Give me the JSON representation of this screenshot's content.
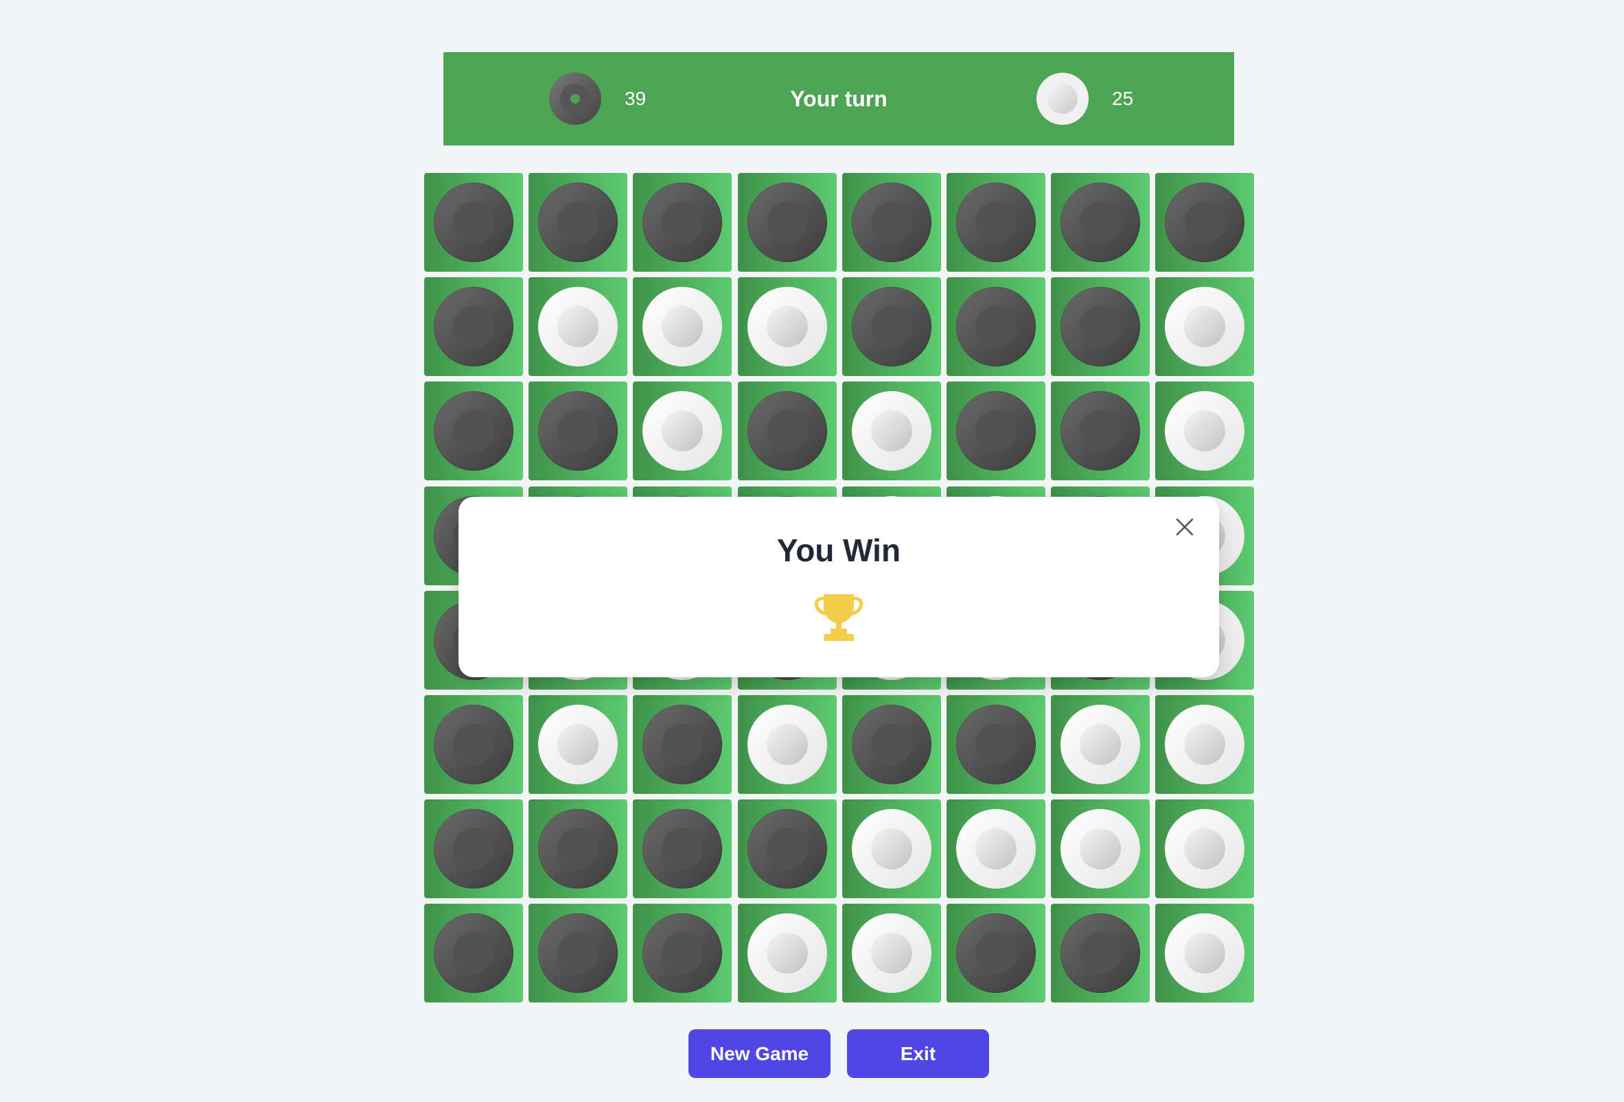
{
  "header": {
    "black_score": "39",
    "white_score": "25",
    "turn_text": "Your turn"
  },
  "board": [
    [
      "black",
      "black",
      "black",
      "black",
      "black",
      "black",
      "black",
      "black"
    ],
    [
      "black",
      "white",
      "white",
      "white",
      "black",
      "black",
      "black",
      "white"
    ],
    [
      "black",
      "black",
      "white",
      "black",
      "white",
      "black",
      "black",
      "white"
    ],
    [
      "black",
      "black",
      "black",
      "black",
      "white",
      "white",
      "black",
      "white"
    ],
    [
      "black",
      "white",
      "white",
      "black",
      "white",
      "white",
      "black",
      "white"
    ],
    [
      "black",
      "white",
      "black",
      "white",
      "black",
      "black",
      "white",
      "white"
    ],
    [
      "black",
      "black",
      "black",
      "black",
      "white",
      "white",
      "white",
      "white"
    ],
    [
      "black",
      "black",
      "black",
      "white",
      "white",
      "black",
      "black",
      "white"
    ]
  ],
  "modal": {
    "title": "You Win",
    "close_icon": "close-icon",
    "trophy_icon": "trophy-icon"
  },
  "buttons": {
    "new_game": "New Game",
    "exit": "Exit"
  },
  "colors": {
    "board_green": "#4ea455",
    "button_indigo": "#4f46e5",
    "trophy_gold": "#f3cd4c"
  }
}
